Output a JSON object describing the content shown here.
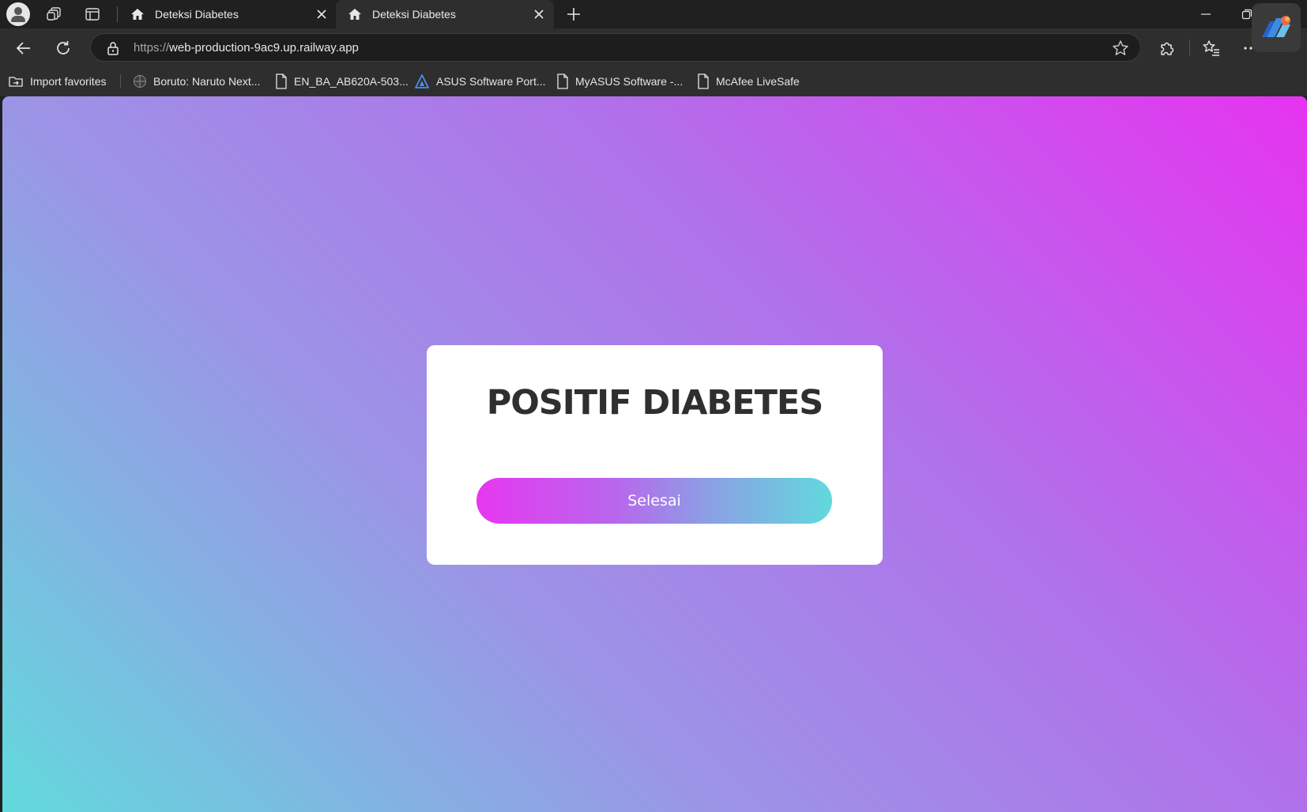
{
  "browser": {
    "tabs": [
      {
        "title": "Deteksi Diabetes",
        "icon": "home-icon",
        "active": false
      },
      {
        "title": "Deteksi Diabetes",
        "icon": "home-icon",
        "active": true
      }
    ],
    "address": {
      "scheme": "https://",
      "host": "web-production-9ac9.up.railway.app"
    },
    "favorites": [
      {
        "label": "Import favorites",
        "icon": "import-icon"
      },
      {
        "label": "Boruto: Naruto Next...",
        "icon": "globe-icon"
      },
      {
        "label": "EN_BA_AB620A-503...",
        "icon": "page-icon"
      },
      {
        "label": "ASUS Software Port...",
        "icon": "asus-icon"
      },
      {
        "label": "MyASUS Software -...",
        "icon": "page-icon"
      },
      {
        "label": "McAfee LiveSafe",
        "icon": "page-icon"
      }
    ]
  },
  "page": {
    "result_title": "POSITIF DIABETES",
    "finish_button": "Selesai",
    "colors": {
      "gradient_start": "#62d9dc",
      "gradient_mid": "#b170ea",
      "gradient_end": "#e633f0",
      "title_text": "#2f2f2f"
    }
  }
}
